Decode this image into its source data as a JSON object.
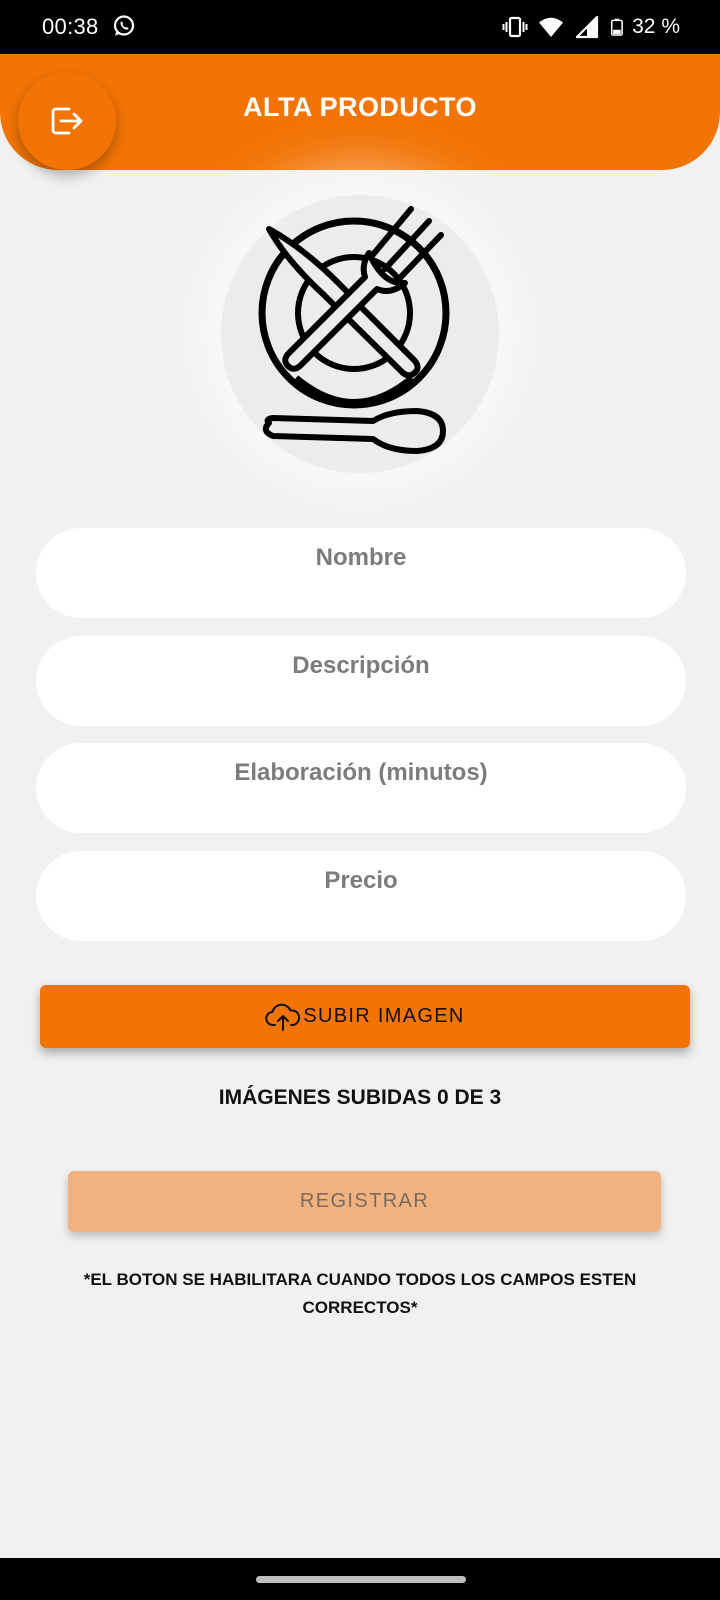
{
  "status_bar": {
    "time": "00:38",
    "battery_text": "32 %",
    "icons": [
      "whatsapp-icon",
      "vibrate-icon",
      "wifi-icon",
      "signal-icon",
      "battery-icon"
    ]
  },
  "header": {
    "title": "ALTA PRODUCTO",
    "logout_icon": "logout-icon"
  },
  "illustration": {
    "icon": "plate-cutlery-icon"
  },
  "form": {
    "name_placeholder": "Nombre",
    "description_placeholder": "Descripción",
    "elaboration_placeholder": "Elaboración (minutos)",
    "price_placeholder": "Precio",
    "name_value": "",
    "description_value": "",
    "elaboration_value": "",
    "price_value": ""
  },
  "upload": {
    "label": "SUBIR IMAGEN",
    "icon": "cloud-upload-icon",
    "count_text": "IMÁGENES SUBIDAS 0 DE 3"
  },
  "register": {
    "label": "REGISTRAR",
    "enabled": false,
    "note": "*EL BOTON SE HABILITARA CUANDO TODOS LOS CAMPOS ESTEN CORRECTOS*"
  },
  "colors": {
    "accent": "#f27405",
    "accent_disabled": "#f1b27f",
    "background": "#f1f1f1",
    "placeholder": "#7c7c7c"
  }
}
